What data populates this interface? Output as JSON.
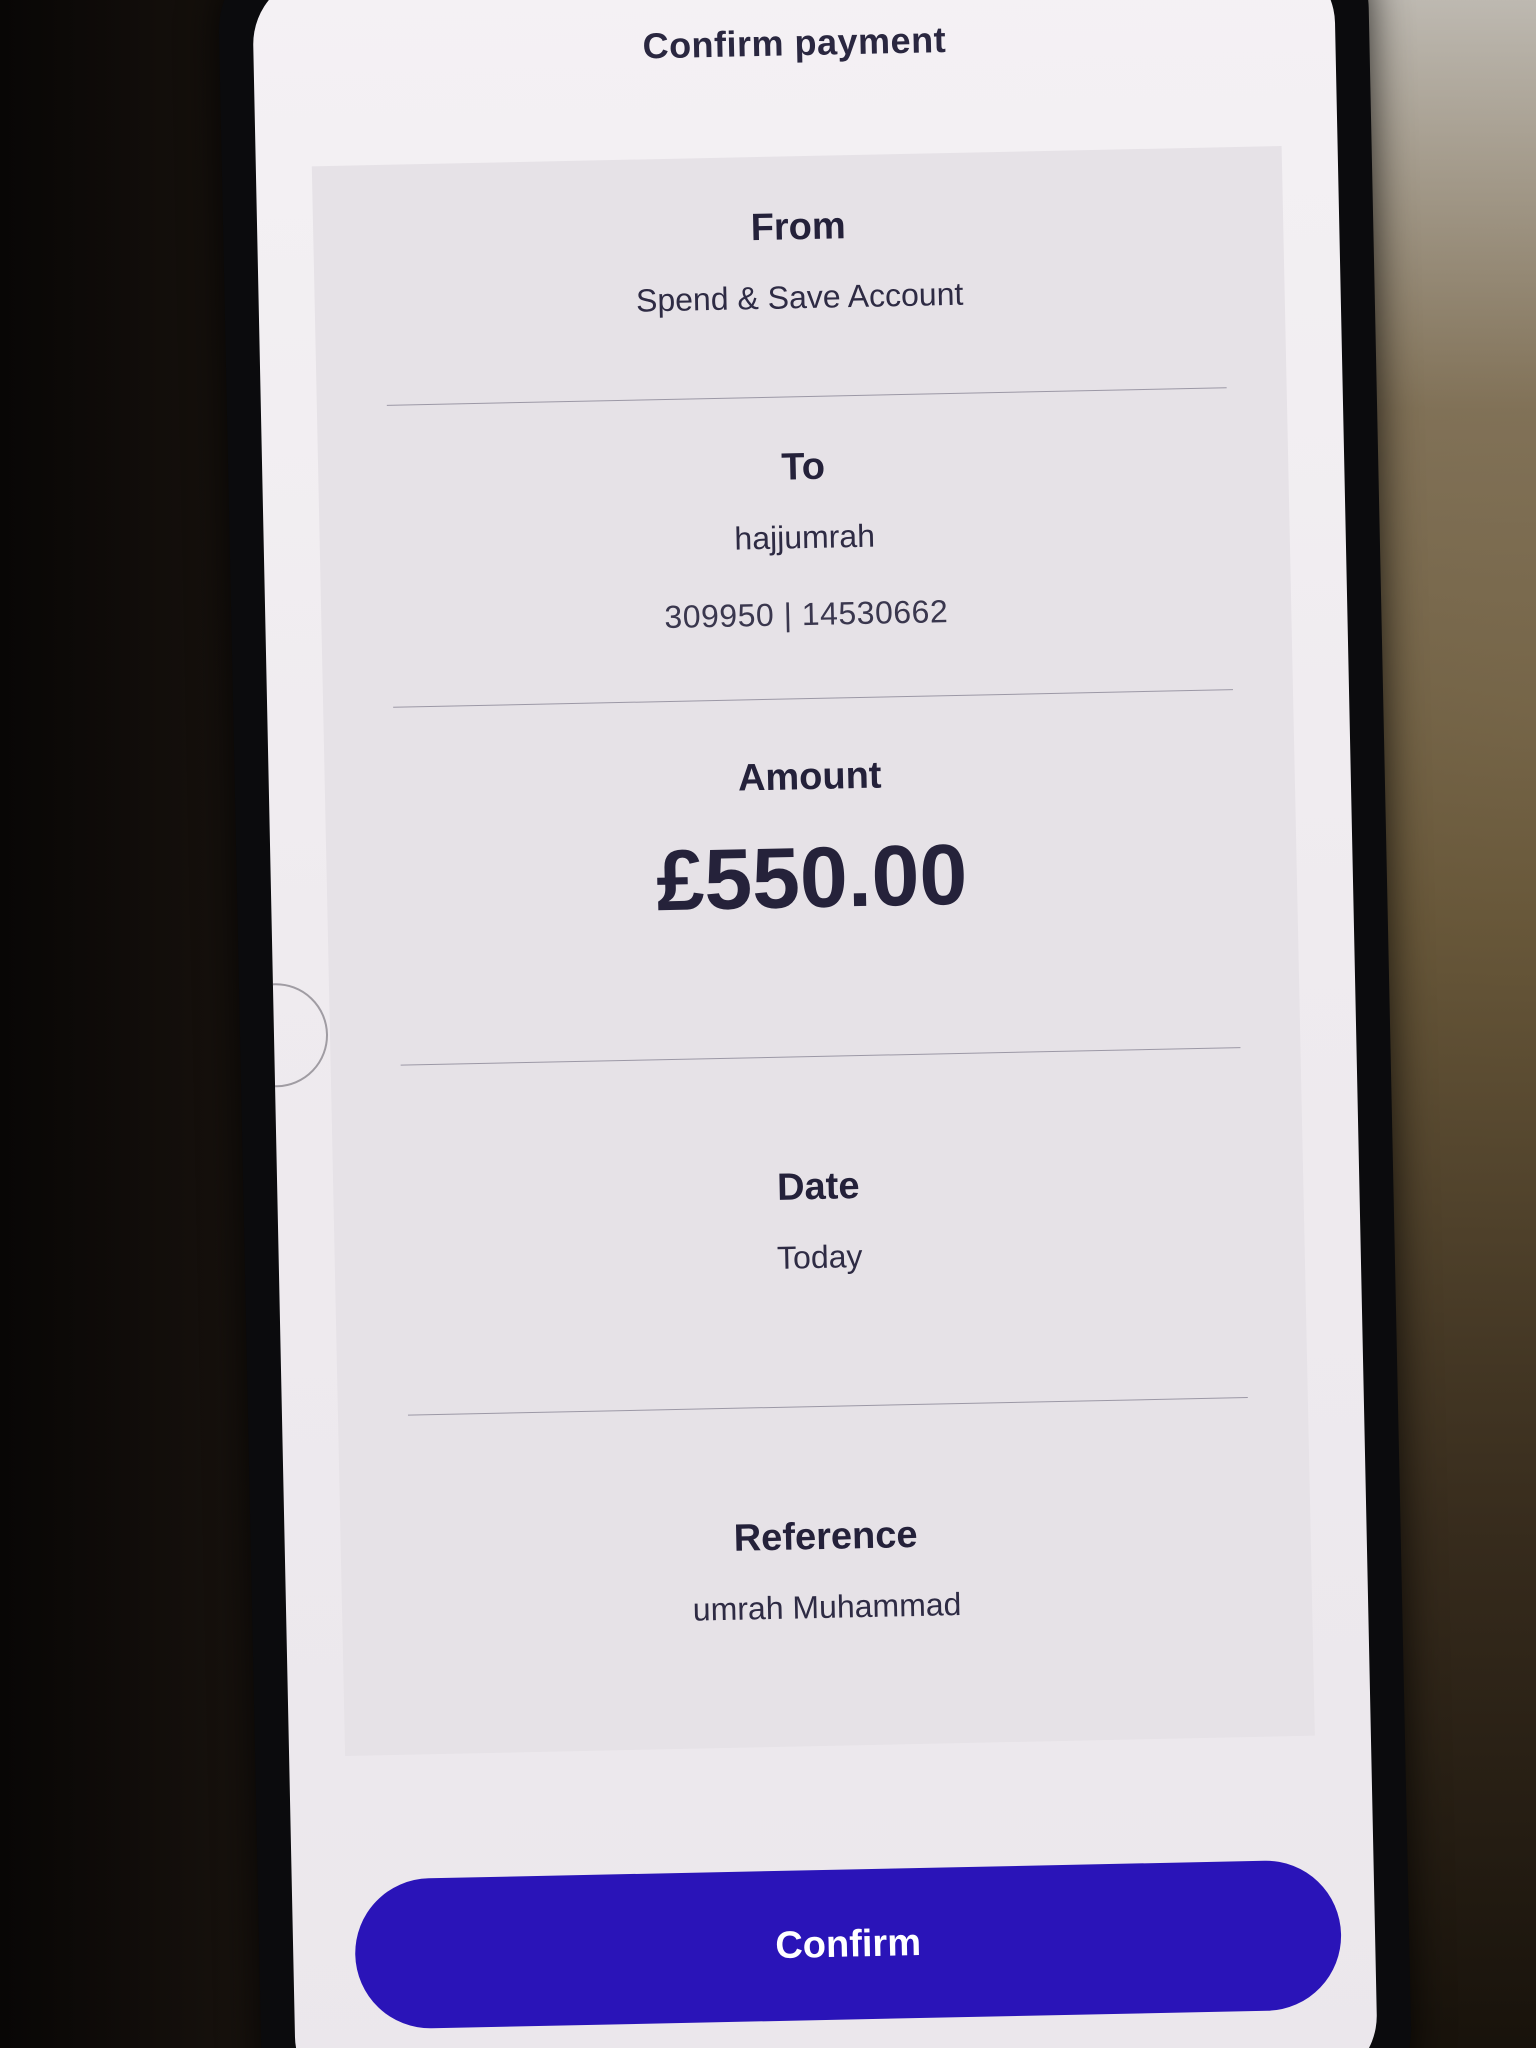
{
  "header": {
    "title": "Confirm payment"
  },
  "from": {
    "label": "From",
    "value": "Spend & Save Account"
  },
  "to": {
    "label": "To",
    "name": "hajjumrah",
    "account": "309950 | 14530662"
  },
  "amount": {
    "label": "Amount",
    "value": "£550.00"
  },
  "date": {
    "label": "Date",
    "value": "Today"
  },
  "reference": {
    "label": "Reference",
    "value": "umrah Muhammad"
  },
  "actions": {
    "confirm_label": "Confirm"
  },
  "colors": {
    "accent": "#2a14b8",
    "text": "#24213a",
    "card": "#e6e2e7"
  }
}
